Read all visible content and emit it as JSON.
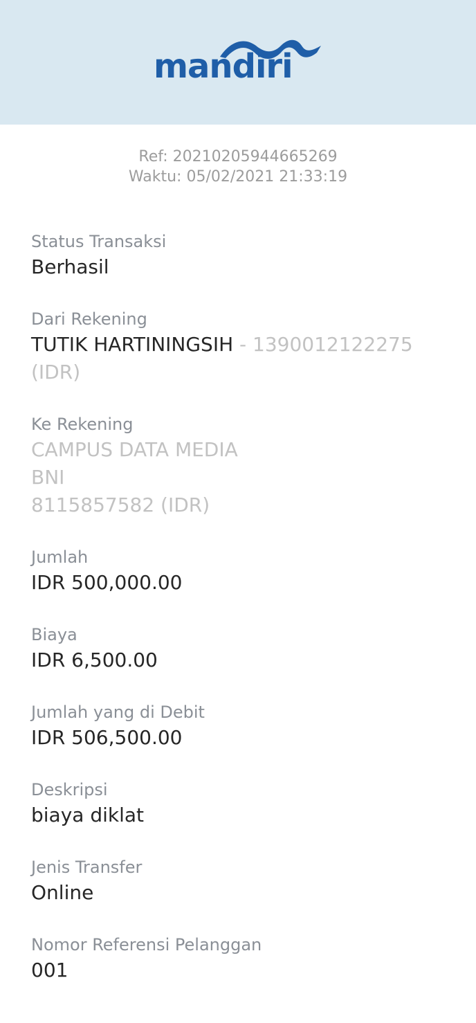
{
  "brand": {
    "logo_text": "mandiri",
    "logo_icon": "mandiri-wave-logo",
    "header_bg": "#d9e8f1",
    "brand_blue": "#1f5ea8"
  },
  "meta": {
    "ref": "Ref: 20210205944665269",
    "time": "Waktu: 05/02/2021 21:33:19"
  },
  "fields": {
    "status": {
      "label": "Status Transaksi",
      "value": "Berhasil"
    },
    "from": {
      "label": "Dari Rekening",
      "name": "TUTIK HARTININGSIH",
      "account": " - 1390012122275",
      "currency": "(IDR)"
    },
    "to": {
      "label": "Ke Rekening",
      "name": "CAMPUS DATA MEDIA",
      "bank": "BNI",
      "account": "8115857582 (IDR)"
    },
    "amount": {
      "label": "Jumlah",
      "value": "IDR 500,000.00"
    },
    "fee": {
      "label": "Biaya",
      "value": "IDR 6,500.00"
    },
    "debited": {
      "label": "Jumlah yang di Debit",
      "value": "IDR 506,500.00"
    },
    "description": {
      "label": "Deskripsi",
      "value": "biaya diklat"
    },
    "transfer_type": {
      "label": "Jenis Transfer",
      "value": "Online"
    },
    "customer_ref": {
      "label": "Nomor Referensi Pelanggan",
      "value": "001"
    }
  }
}
